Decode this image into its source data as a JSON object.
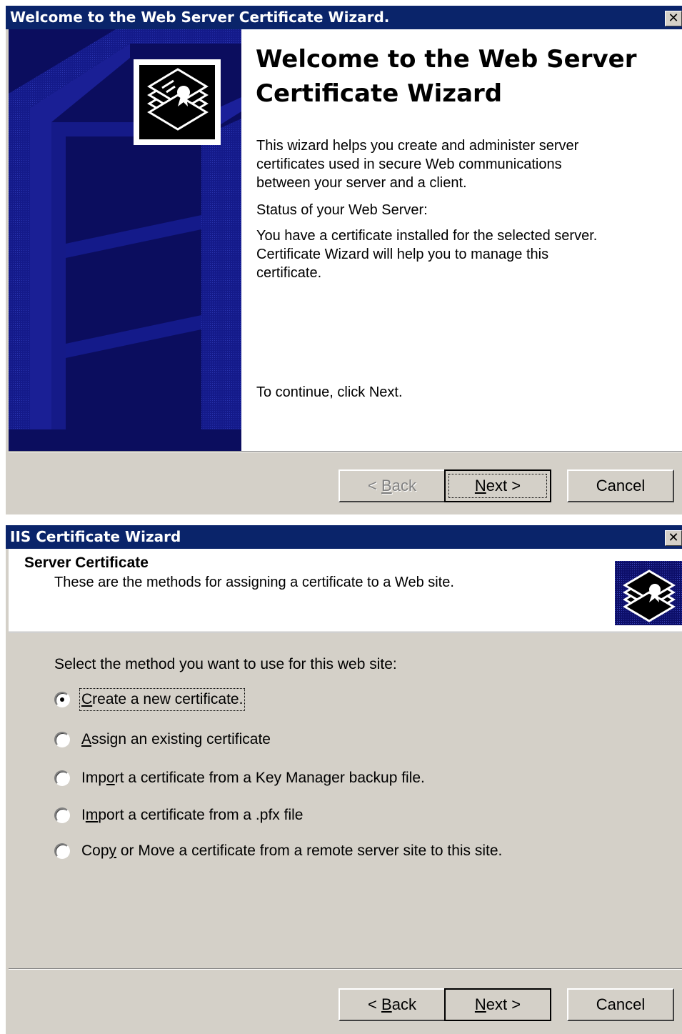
{
  "welcome_dialog": {
    "title": "Welcome to the Web Server Certificate Wizard.",
    "close_glyph": "✕",
    "heading": "Welcome to the Web Server Certificate Wizard",
    "intro": "This wizard helps you create and administer server certificates used in secure Web communications between your server and a client.",
    "status_label": "Status of your Web Server:",
    "status_text": "You have a certificate installed for the selected server. Certificate Wizard will help you to manage this certificate.",
    "continue_text": "To continue, click Next.",
    "buttons": {
      "back": {
        "prefix": "< ",
        "accel": "B",
        "rest": "ack",
        "enabled": false
      },
      "next": {
        "accel": "N",
        "rest": "ext >",
        "default": true
      },
      "cancel": "Cancel"
    },
    "icons": {
      "banner": "certificate-icon"
    },
    "colors": {
      "titlebar": "#0a246a",
      "banner": "#0d0f6a",
      "face": "#d4d0c8"
    }
  },
  "cert_dialog": {
    "title": "IIS Certificate Wizard",
    "close_glyph": "✕",
    "header_title": "Server Certificate",
    "header_subtitle": "These are the methods for assigning a certificate to a Web site.",
    "prompt": "Select the method you want to use for this web site:",
    "options": [
      {
        "pre": "",
        "accel": "C",
        "post": "reate a new certificate.",
        "checked": true
      },
      {
        "pre": "",
        "accel": "A",
        "post": "ssign an existing certificate",
        "checked": false
      },
      {
        "pre": "Imp",
        "accel": "o",
        "post": "rt a certificate from a Key Manager backup file.",
        "checked": false
      },
      {
        "pre": "I",
        "accel": "m",
        "post": "port a certificate from a .pfx file",
        "checked": false
      },
      {
        "pre": "Cop",
        "accel": "y",
        "post": " or Move a certificate from a remote server site to this site.",
        "checked": false
      }
    ],
    "buttons": {
      "back": {
        "prefix": "< ",
        "accel": "B",
        "rest": "ack"
      },
      "next": {
        "accel": "N",
        "rest": "ext >"
      },
      "cancel": "Cancel"
    },
    "icons": {
      "header": "certificate-icon"
    }
  }
}
